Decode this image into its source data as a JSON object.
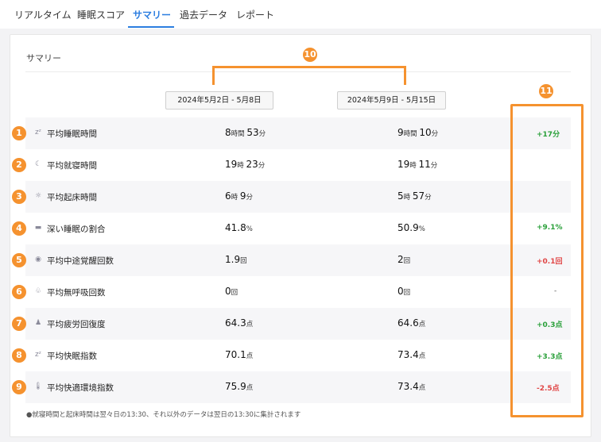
{
  "tabs": [
    {
      "label": "リアルタイム"
    },
    {
      "label": "睡眠スコア"
    },
    {
      "label": "サマリー"
    },
    {
      "label": "過去データ"
    },
    {
      "label": "レポート"
    }
  ],
  "card": {
    "title": "サマリー",
    "period1": "2024年5月2日 - 5月8日",
    "period2": "2024年5月9日 - 5月15日",
    "callout_bracket": "10",
    "callout_diff": "11",
    "footnote": "●就寝時間と起床時間は翌々日の13:30、それ以外のデータは翌日の13:30に集計されます"
  },
  "rows": [
    {
      "num": "1",
      "icon": "sleep-icon",
      "label": "平均睡眠時間",
      "v1": [
        "8",
        "時間 ",
        "53",
        "分"
      ],
      "v2": [
        "9",
        "時間 ",
        "10",
        "分"
      ],
      "diff": "+17分",
      "diff_kind": "pos"
    },
    {
      "num": "2",
      "icon": "moon-icon",
      "label": "平均就寝時間",
      "v1": [
        "19",
        "時 ",
        "23",
        "分"
      ],
      "v2": [
        "19",
        "時 ",
        "11",
        "分"
      ],
      "diff": "",
      "diff_kind": "none"
    },
    {
      "num": "3",
      "icon": "sun-icon",
      "label": "平均起床時間",
      "v1": [
        "6",
        "時 ",
        "9",
        "分"
      ],
      "v2": [
        "5",
        "時 ",
        "57",
        "分"
      ],
      "diff": "",
      "diff_kind": "none"
    },
    {
      "num": "4",
      "icon": "bed-icon",
      "label": "深い睡眠の割合",
      "v1": [
        "41.8",
        "%"
      ],
      "v2": [
        "50.9",
        "%"
      ],
      "diff": "+9.1%",
      "diff_kind": "pos"
    },
    {
      "num": "5",
      "icon": "eye-icon",
      "label": "平均中途覚醒回数",
      "v1": [
        "1.9",
        "回"
      ],
      "v2": [
        "2",
        "回"
      ],
      "diff": "+0.1回",
      "diff_kind": "neg"
    },
    {
      "num": "6",
      "icon": "lungs-icon",
      "label": "平均無呼吸回数",
      "v1": [
        "0",
        "回"
      ],
      "v2": [
        "0",
        "回"
      ],
      "diff": "-",
      "diff_kind": "neutral"
    },
    {
      "num": "7",
      "icon": "recovery-icon",
      "label": "平均疲労回復度",
      "v1": [
        "64.3",
        "点"
      ],
      "v2": [
        "64.6",
        "点"
      ],
      "diff": "+0.3点",
      "diff_kind": "pos"
    },
    {
      "num": "8",
      "icon": "sleep-icon",
      "label": "平均快眠指数",
      "v1": [
        "70.1",
        "点"
      ],
      "v2": [
        "73.4",
        "点"
      ],
      "diff": "+3.3点",
      "diff_kind": "pos"
    },
    {
      "num": "9",
      "icon": "thermometer-icon",
      "label": "平均快適環境指数",
      "v1": [
        "75.9",
        "点"
      ],
      "v2": [
        "73.4",
        "点"
      ],
      "diff": "-2.5点",
      "diff_kind": "neg"
    }
  ]
}
